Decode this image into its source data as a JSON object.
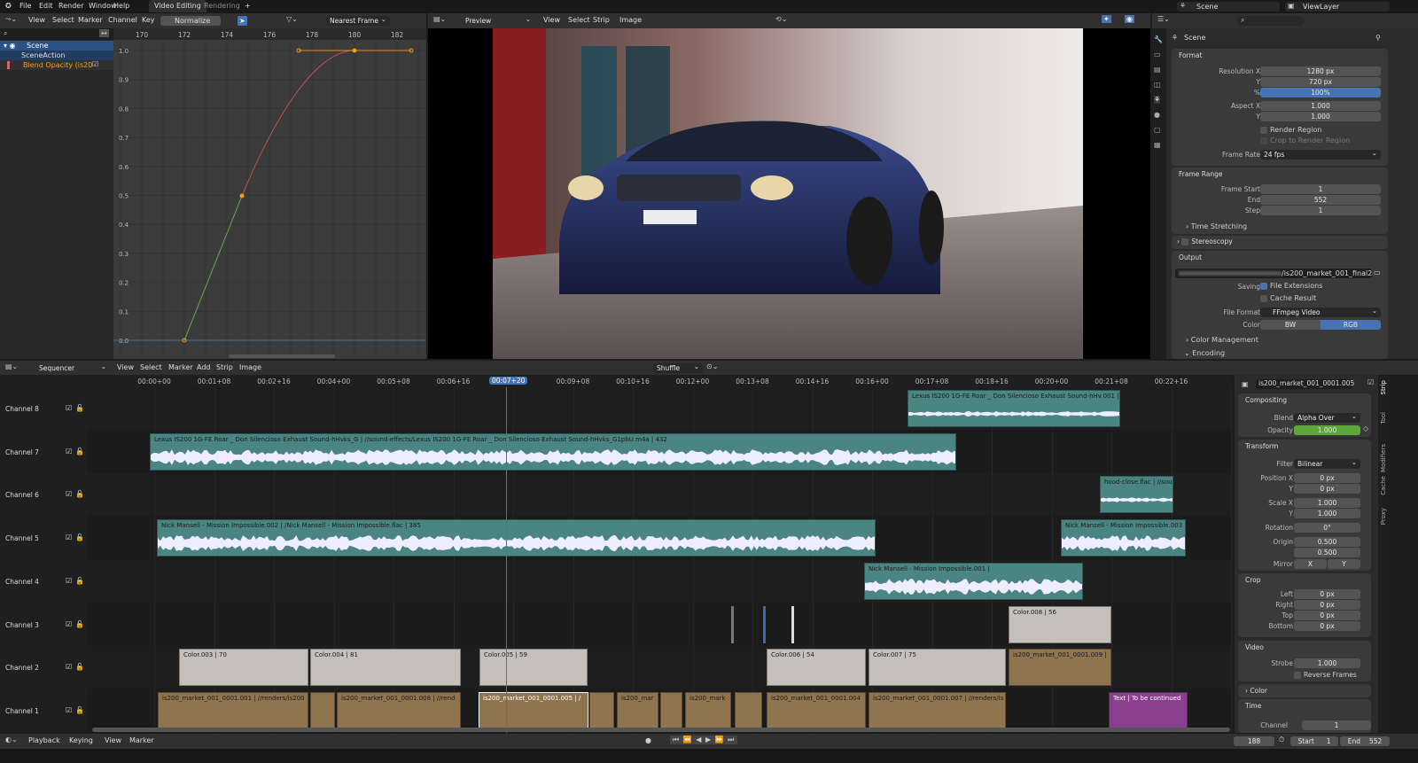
{
  "menu": {
    "items": [
      "File",
      "Edit",
      "Render",
      "Window",
      "Help"
    ],
    "workspaces": [
      "Video Editing",
      "Rendering"
    ],
    "add": "+"
  },
  "graph": {
    "menus": [
      "View",
      "Select",
      "Marker",
      "Channel",
      "Key"
    ],
    "normalize": "Normalize",
    "snap": "Nearest Frame",
    "ruler": [
      "170",
      "172",
      "174",
      "176",
      "178",
      "180",
      "182"
    ],
    "yticks": [
      "1.0",
      "0.9",
      "0.8",
      "0.7",
      "0.6",
      "0.5",
      "0.4",
      "0.3",
      "0.2",
      "0.1",
      "0.0"
    ],
    "channels": [
      "Scene",
      "SceneAction",
      "Blend Opacity (is20"
    ]
  },
  "preview": {
    "mode": "Preview",
    "menus": [
      "View",
      "Select",
      "Strip",
      "Image"
    ]
  },
  "topright": {
    "scene": "Scene",
    "view_layer": "ViewLayer"
  },
  "props": {
    "context": "Scene",
    "format": {
      "title": "Format",
      "resx_label": "Resolution X",
      "resx": "1280 px",
      "y_label": "Y",
      "resy": "720 px",
      "pct_label": "%",
      "pct": "100%",
      "aspect_label": "Aspect X",
      "ax": "1.000",
      "ay_label": "Y",
      "ay": "1.000",
      "render_region": "Render Region",
      "crop": "Crop to Render Region",
      "fr_label": "Frame Rate",
      "fr": "24 fps"
    },
    "frame_range": {
      "title": "Frame Range",
      "start_label": "Frame Start",
      "start": "1",
      "end_label": "End",
      "end": "552",
      "step_label": "Step",
      "step": "1",
      "time_stretching": "Time Stretching"
    },
    "stereoscopy": "Stereoscopy",
    "output": {
      "title": "Output",
      "path": "/is200_market_001_final2_",
      "saving": "Saving",
      "file_ext": "File Extensions",
      "cache": "Cache Result",
      "ff_label": "File Format",
      "ff": "FFmpeg Video",
      "color_label": "Color",
      "bw": "BW",
      "rgb": "RGB",
      "color_mgmt": "Color Management",
      "encoding": "Encoding"
    }
  },
  "seq": {
    "mode": "Sequencer",
    "menus": [
      "View",
      "Select",
      "Marker",
      "Add",
      "Strip",
      "Image"
    ],
    "overlap": "Shuffle",
    "current": "00:07+20",
    "ruler": [
      "00:00+00",
      "00:01+08",
      "00:02+16",
      "00:04+00",
      "00:05+08",
      "00:06+16",
      "",
      "00:09+08",
      "00:10+16",
      "00:12+00",
      "00:13+08",
      "00:14+16",
      "00:16+00",
      "00:17+08",
      "00:18+16",
      "00:20+00",
      "00:21+08",
      "00:22+16"
    ],
    "channels": [
      "Channel 8",
      "Channel 7",
      "Channel 6",
      "Channel 5",
      "Channel 4",
      "Channel 3",
      "Channel 2",
      "Channel 1"
    ],
    "strips": [
      "Lexus IS200 1G-FE Roar _ Don Silencioso Exhaust Sound-hHv.001 |",
      "Lexus IS200 1G-FE Roar _ Don Silencioso Exhaust Sound-hHvks_G | //sound-effects/Lexus IS200 1G-FE Roar _ Don Silencioso Exhaust Sound-hHvks_G1pbU.m4a | 432",
      "hood-close.flac | //sou",
      "Nick Mansell - Mission Impossible.002 |                                         /Nick Mansell - Mission Impossible.flac | 385",
      "Nick Mansell - Mission Impossible.003 |",
      "Nick Mansell - Mission Impossible.001 |",
      "Color.008 | 56",
      "Color.003 | 70",
      "Color.004 | 81",
      "Color.005 | 59",
      "Color.006 | 54",
      "Color.007 | 75",
      "is200_market_001_0001.009 |",
      "is200_market_001_0001.001 | //renders/is200",
      "is200_market_001_0001.008 | //rend",
      "is200_market_001_0001.005 | /",
      "is200_mar",
      "is200_mark",
      "is200_market_001_0001.004",
      "is200_market_001_0001.007 | //renders/is",
      "Text | To be continued"
    ]
  },
  "sidebar": {
    "strip_name": "is200_market_001_0001.005",
    "tabs": [
      "Strip",
      "Tool",
      "Modifiers",
      "Cache",
      "Proxy"
    ],
    "compositing": "Compositing",
    "blend_label": "Blend",
    "blend": "Alpha Over",
    "opacity_label": "Opacity",
    "opacity": "1.000",
    "transform": "Transform",
    "filter_label": "Filter",
    "filter": "Bilinear",
    "posx_label": "Position X",
    "posx": "0 px",
    "posy_label": "Y",
    "posy": "0 px",
    "scalex_label": "Scale X",
    "scalex": "1.000",
    "scaley_label": "Y",
    "scaley": "1.000",
    "rot_label": "Rotation",
    "rot": "0°",
    "origin_label": "Origin",
    "ox": "0.500",
    "oy": "0.500",
    "mirror_label": "Mirror",
    "mx": "X",
    "my": "Y",
    "crop": "Crop",
    "left_label": "Left",
    "left": "0 px",
    "right_label": "Right",
    "right": "0 px",
    "top_label": "Top",
    "top": "0 px",
    "bottom_label": "Bottom",
    "bottom": "0 px",
    "video": "Video",
    "strobe_label": "Strobe",
    "strobe": "1.000",
    "reverse": "Reverse Frames",
    "color": "Color",
    "time": "Time",
    "channel_label": "Channel",
    "channel": "1"
  },
  "status": {
    "menus": [
      "Playback",
      "Keying",
      "View",
      "Marker"
    ],
    "frame": "188",
    "start_label": "Start",
    "start": "1",
    "end_label": "End",
    "end": "552"
  },
  "colors": {
    "accent": "#4772b3",
    "sound": "#4a8581",
    "color_strip": "#c5c0ba",
    "image": "#8f7450",
    "text": "#8a3f8f",
    "opacity": "#5fa63a"
  }
}
